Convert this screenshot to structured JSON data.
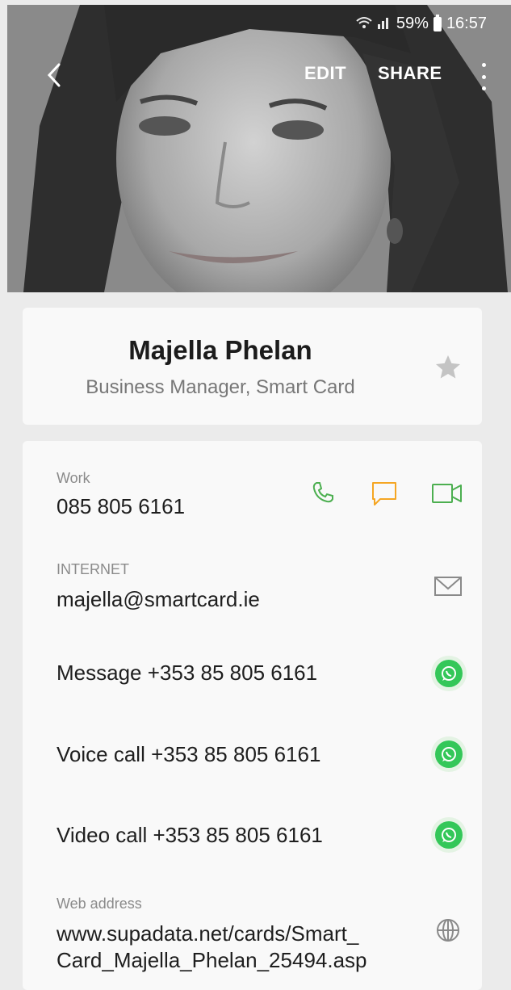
{
  "status_bar": {
    "battery": "59%",
    "time": "16:57"
  },
  "toolbar": {
    "edit_label": "EDIT",
    "share_label": "SHARE"
  },
  "contact": {
    "name": "Majella Phelan",
    "subtitle": "Business Manager, Smart Card"
  },
  "phone": {
    "label": "Work",
    "number": "085 805 6161"
  },
  "email": {
    "label": "INTERNET",
    "address": "majella@smartcard.ie"
  },
  "whatsapp": {
    "message": "Message +353 85 805 6161",
    "voice": "Voice call +353 85 805 6161",
    "video": "Video call +353 85 805 6161"
  },
  "web": {
    "label": "Web address",
    "line1": "www.supadata.net/cards/Smart_",
    "line2": "Card_Majella_Phelan_25494.asp"
  },
  "colors": {
    "call_green": "#4caf50",
    "message_orange": "#f5a623",
    "video_green": "#4caf50",
    "whatsapp_green": "#34c759"
  },
  "icons": [
    "back-icon",
    "more-icon",
    "star-icon",
    "phone-icon",
    "message-icon",
    "video-icon",
    "mail-icon",
    "whatsapp-icon",
    "globe-icon",
    "wifi-icon",
    "signal-icon",
    "battery-icon"
  ]
}
